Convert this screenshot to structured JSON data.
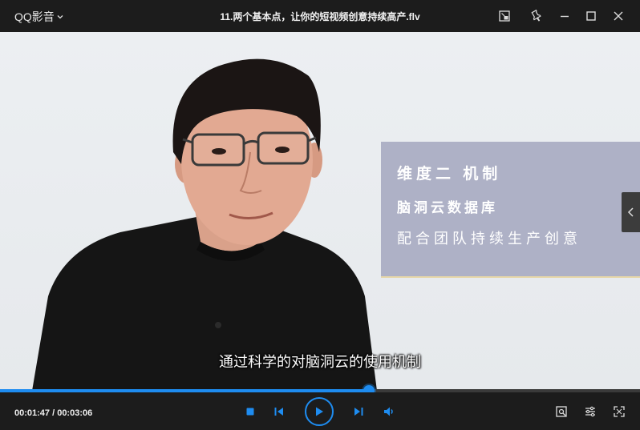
{
  "titlebar": {
    "app_name": "QQ影音",
    "file_title": "11.两个基本点，让你的短视频创意持续高产.flv"
  },
  "video": {
    "card": {
      "line1": "维度二 机制",
      "line2": "脑洞云数据库",
      "line3": "配合团队持续生产创意"
    },
    "subtitle": "通过科学的对脑洞云的使用机制"
  },
  "playback": {
    "current_time": "00:01:47",
    "total_time": "00:03:06",
    "time_display": "00:01:47 / 00:03:06",
    "progress_fraction": 0.577,
    "state": "paused"
  },
  "colors": {
    "accent": "#1e8cf0",
    "titlebar_bg": "#1c1c1c",
    "card_bg": "#aeb1c6"
  },
  "icons": {
    "titlebar": [
      "app-menu-chevron-icon",
      "picture-in-picture-icon",
      "pin-icon",
      "minimize-icon",
      "maximize-icon",
      "close-icon"
    ],
    "controls": [
      "stop-icon",
      "previous-icon",
      "play-icon",
      "next-icon",
      "volume-icon",
      "screenshot-icon",
      "settings-icon",
      "fullscreen-icon"
    ],
    "side": [
      "chevron-left-icon"
    ]
  }
}
